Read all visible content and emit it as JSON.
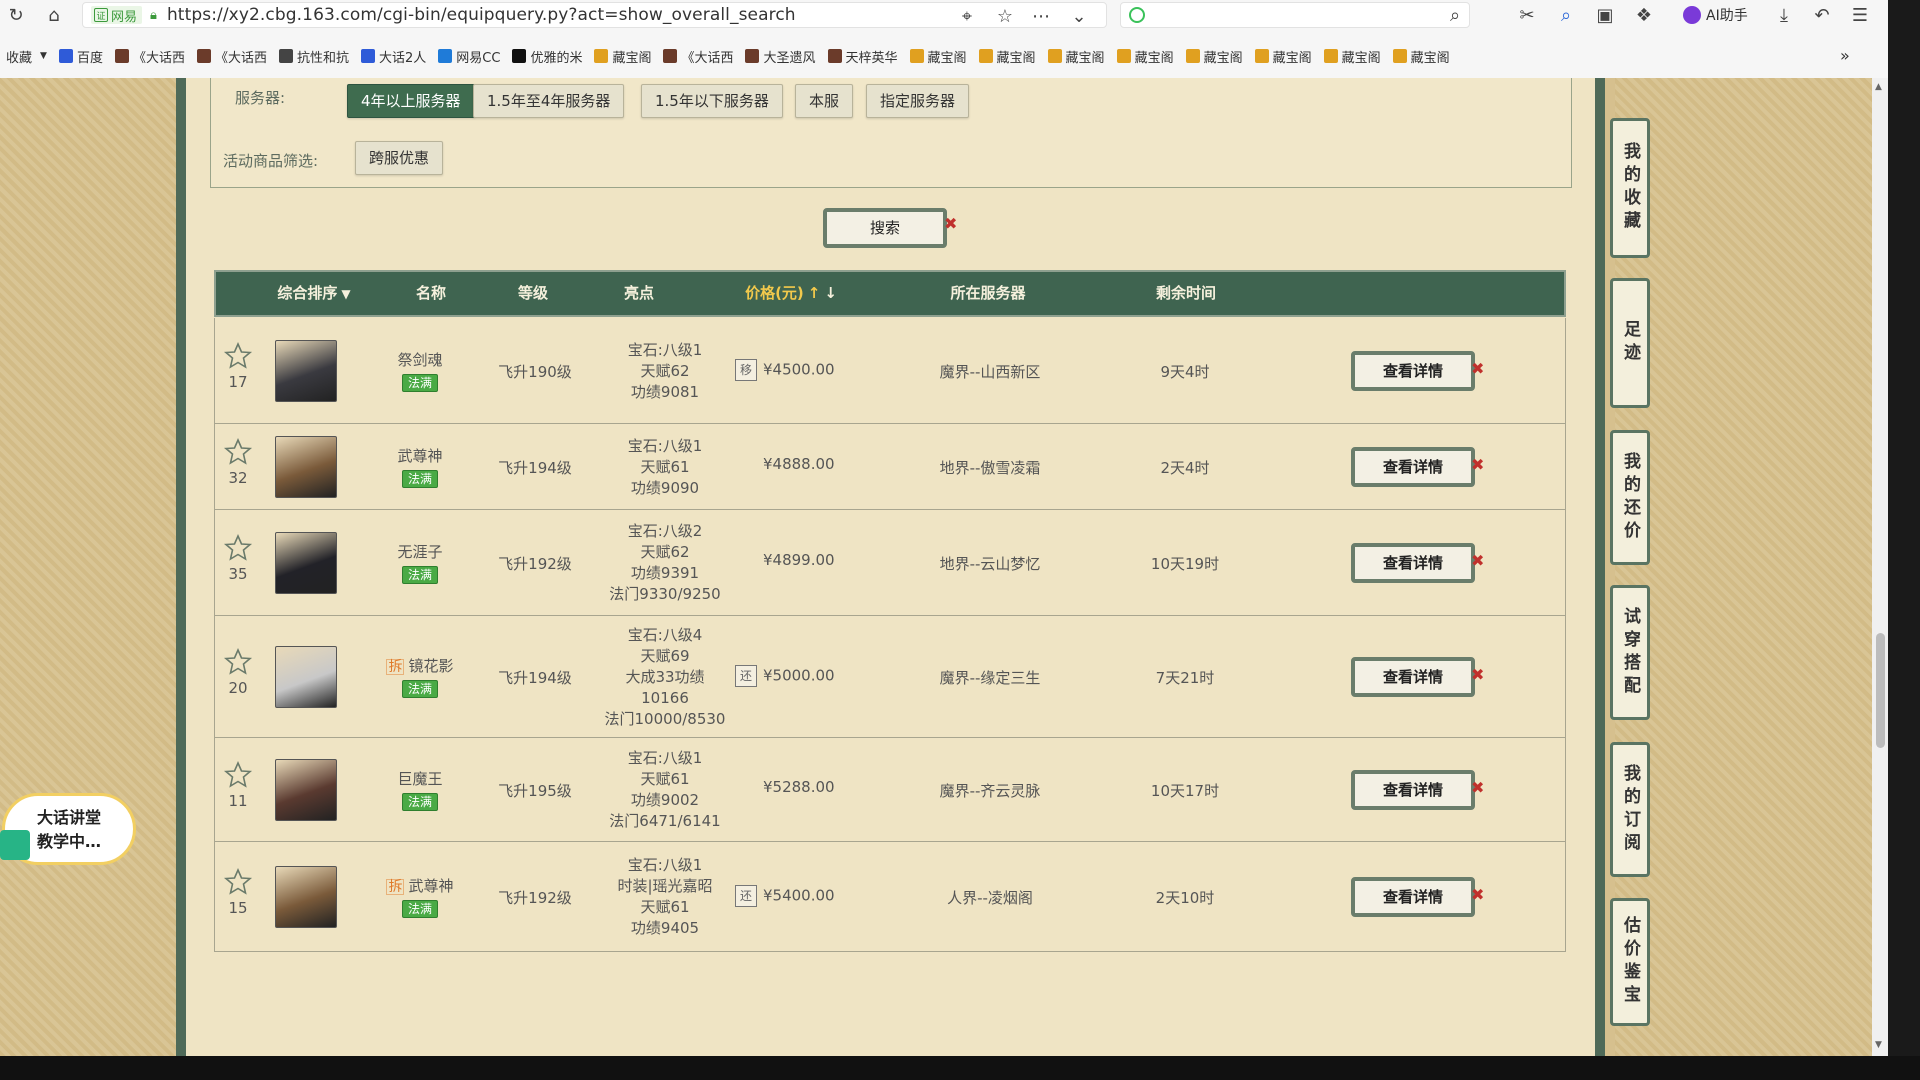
{
  "browser": {
    "url_badge": "网易",
    "url": "https://xy2.cbg.163.com/cgi-bin/equipquery.py?act=show_overall_search",
    "search_placeholder": "",
    "ai_label": "AI助手",
    "bookmarks_label": "收藏",
    "bookmarks": [
      {
        "label": "百度",
        "color": "#2f5bd8"
      },
      {
        "label": "《大话西",
        "color": "#6b3b2a"
      },
      {
        "label": "《大话西",
        "color": "#6b3b2a"
      },
      {
        "label": "抗性和抗",
        "color": "#444444"
      },
      {
        "label": "大话2人",
        "color": "#2f5bd8"
      },
      {
        "label": "网易CC",
        "color": "#1f7bd8"
      },
      {
        "label": "优雅的米",
        "color": "#111111"
      },
      {
        "label": "藏宝阁",
        "color": "#e0a020"
      },
      {
        "label": "《大话西",
        "color": "#6b3b2a"
      },
      {
        "label": "大圣遗风",
        "color": "#6b3b2a"
      },
      {
        "label": "天梓英华",
        "color": "#6b3b2a"
      },
      {
        "label": "藏宝阁",
        "color": "#e0a020"
      },
      {
        "label": "藏宝阁",
        "color": "#e0a020"
      },
      {
        "label": "藏宝阁",
        "color": "#e0a020"
      },
      {
        "label": "藏宝阁",
        "color": "#e0a020"
      },
      {
        "label": "藏宝阁",
        "color": "#e0a020"
      },
      {
        "label": "藏宝阁",
        "color": "#e0a020"
      },
      {
        "label": "藏宝阁",
        "color": "#e0a020"
      },
      {
        "label": "藏宝阁",
        "color": "#e0a020"
      }
    ],
    "more": "»"
  },
  "filters": {
    "server_label": "服务器:",
    "server_options": [
      "4年以上服务器",
      "1.5年至4年服务器",
      "1.5年以下服务器",
      "本服",
      "指定服务器"
    ],
    "promo_label": "活动商品筛选:",
    "promo_options": [
      "跨服优惠"
    ],
    "search_label": "搜索"
  },
  "table": {
    "headers": {
      "sort": "综合排序",
      "name": "名称",
      "level": "等级",
      "highlight": "亮点",
      "price": "价格(元)",
      "server": "所在服务器",
      "time": "剩余时间"
    },
    "detail_label": "查看详情",
    "rows": [
      {
        "fav": "17",
        "name": "祭剑魂",
        "chai": "",
        "tag": "法满",
        "level": "飞升190级",
        "highlights": [
          "宝石:八级1",
          "天赋62",
          "功绩9081"
        ],
        "price_icon": "移",
        "price": "¥4500.00",
        "server": "魔界--山西新区",
        "time": "9天4时",
        "avatar": "#3a3a40"
      },
      {
        "fav": "32",
        "name": "武尊神",
        "chai": "",
        "tag": "法满",
        "level": "飞升194级",
        "highlights": [
          "宝石:八级1",
          "天赋61",
          "功绩9090"
        ],
        "price_icon": "",
        "price": "¥4888.00",
        "server": "地界--傲雪凌霜",
        "time": "2天4时",
        "avatar": "#7a5a3a"
      },
      {
        "fav": "35",
        "name": "无涯子",
        "chai": "",
        "tag": "法满",
        "level": "飞升192级",
        "highlights": [
          "宝石:八级2",
          "天赋62",
          "功绩9391",
          "法门9330/9250"
        ],
        "price_icon": "",
        "price": "¥4899.00",
        "server": "地界--云山梦忆",
        "time": "10天19时",
        "avatar": "#222228"
      },
      {
        "fav": "20",
        "name": "镜花影",
        "chai": "拆",
        "tag": "法满",
        "level": "飞升194级",
        "highlights": [
          "宝石:八级4",
          "天赋69",
          "大成33功绩",
          "10166",
          "法门10000/8530"
        ],
        "price_icon": "还",
        "price": "¥5000.00",
        "server": "魔界--缘定三生",
        "time": "7天21时",
        "avatar": "#c8c8c8"
      },
      {
        "fav": "11",
        "name": "巨魔王",
        "chai": "",
        "tag": "法满",
        "level": "飞升195级",
        "highlights": [
          "宝石:八级1",
          "天赋61",
          "功绩9002",
          "法门6471/6141"
        ],
        "price_icon": "",
        "price": "¥5288.00",
        "server": "魔界--齐云灵脉",
        "time": "10天17时",
        "avatar": "#5a3a30"
      },
      {
        "fav": "15",
        "name": "武尊神",
        "chai": "拆",
        "tag": "法满",
        "level": "飞升192级",
        "highlights": [
          "宝石:八级1",
          "时装|瑶光嘉昭",
          "天赋61",
          "功绩9405"
        ],
        "price_icon": "还",
        "price": "¥5400.00",
        "server": "人界--凌烟阁",
        "time": "2天10时",
        "avatar": "#7a5a3a"
      }
    ]
  },
  "side_tabs": [
    {
      "label": "我的收藏"
    },
    {
      "label": "足迹"
    },
    {
      "label": "我的还价"
    },
    {
      "label": "试穿搭配"
    },
    {
      "label": "我的订阅"
    },
    {
      "label": "估价鉴宝"
    }
  ],
  "helper": {
    "line1": "大话讲堂",
    "line2": "教学中…"
  }
}
